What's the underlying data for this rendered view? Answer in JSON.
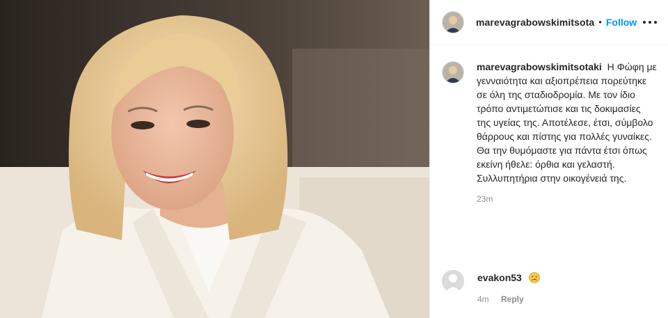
{
  "post": {
    "username": "marevagrabowskimitsota",
    "follow_label": "Follow",
    "dot": "•",
    "photo_subject": "woman-portrait-photo"
  },
  "caption": {
    "username": "marevagrabowskimitsotaki",
    "text": "Η Φώφη με γενναιότητα και αξιοπρέπεια πορεύτηκε σε όλη της σταδιοδρομία. Με τον ίδιο τρόπο αντιμετώπισε και τις δοκιμασίες της υγείας της. Αποτέλεσε, έτσι, σύμβολο θάρρους και πίστης για πολλές γυναίκες. Θα την θυμόμαστε για πάντα έτσι όπως εκείνη ήθελε: όρθια και γελαστή. Συλλυπητήρια στην οικογένειά της.",
    "time": "23m"
  },
  "comment": {
    "username": "evakon53",
    "emoji": "disappointed-face-emoji",
    "time": "4m",
    "reply_label": "Reply"
  },
  "colors": {
    "link_blue": "#0095f6",
    "text": "#262626",
    "secondary": "#8e8e8e",
    "border": "#efefef"
  }
}
